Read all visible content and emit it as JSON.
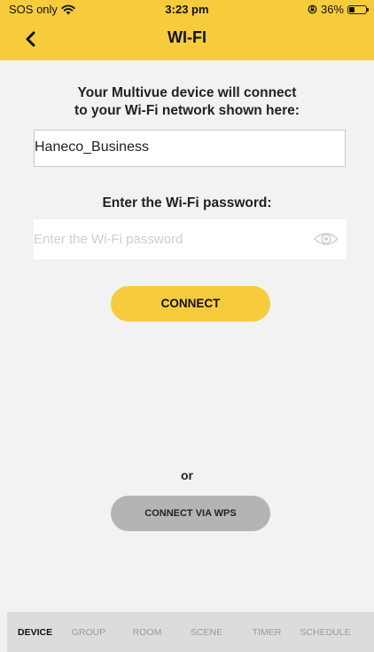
{
  "status_bar": {
    "carrier": "SOS only",
    "time": "3:23 pm",
    "battery": "36%",
    "battery_level": 0.36
  },
  "nav": {
    "title": "WI-FI"
  },
  "intro": {
    "line1": "Your Multivue device will connect",
    "line2": "to your Wi-Fi network shown here:"
  },
  "ssid": {
    "value": "Haneco_Business"
  },
  "password": {
    "label": "Enter the Wi-Fi password:",
    "placeholder": "Enter the Wi-Fi password",
    "value": ""
  },
  "buttons": {
    "connect": "CONNECT",
    "or": "or",
    "wps": "CONNECT VIA WPS"
  },
  "tabs": [
    {
      "label": "DEVICE",
      "active": true
    },
    {
      "label": "GROUP",
      "active": false
    },
    {
      "label": "ROOM",
      "active": false
    },
    {
      "label": "SCENE",
      "active": false
    },
    {
      "label": "TIMER",
      "active": false
    },
    {
      "label": "SCHEDULE",
      "active": false
    }
  ],
  "colors": {
    "accent": "#f6cc3c",
    "background": "#f2f2f2",
    "wps_button": "#b4b4b4",
    "tabbar": "#dcdcdc"
  }
}
